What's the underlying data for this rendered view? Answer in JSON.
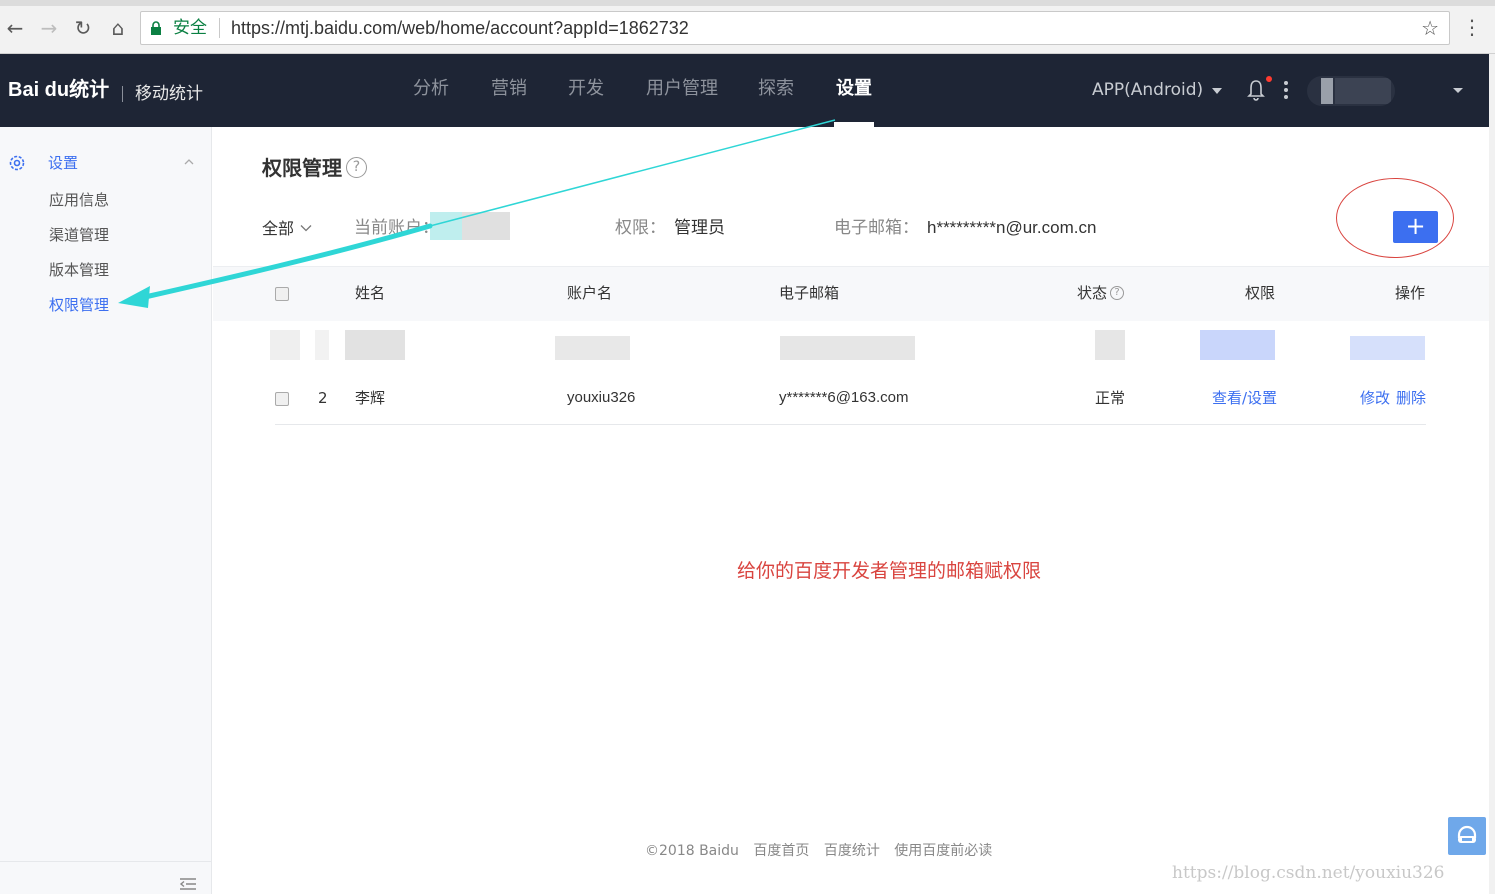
{
  "browser": {
    "secure_label": "安全",
    "url": "https://mtj.baidu.com/web/home/account?appId=1862732"
  },
  "header": {
    "logo": "Bai du统计",
    "product": "移动统计",
    "nav": [
      "分析",
      "营销",
      "开发",
      "用户管理",
      "探索",
      "设置"
    ],
    "active_nav": "设置",
    "app_select": "APP(Android)"
  },
  "sidebar": {
    "group": "设置",
    "items": [
      "应用信息",
      "渠道管理",
      "版本管理",
      "权限管理"
    ],
    "active_item": "权限管理"
  },
  "main": {
    "title": "权限管理",
    "help": "?",
    "filter": "全部",
    "current_account_label": "当前账户：",
    "permission_label": "权限：",
    "permission_value": "管理员",
    "email_label": "电子邮箱：",
    "email_value": "h*********n@ur.com.cn",
    "add_label": "+"
  },
  "table": {
    "columns": [
      "姓名",
      "账户名",
      "电子邮箱",
      "状态",
      "权限",
      "操作"
    ],
    "rows": [
      {
        "index": "2",
        "name": "李辉",
        "account": "youxiu326",
        "email": "y*******6@163.com",
        "status": "正常",
        "permission": "查看/设置",
        "edit": "修改",
        "delete": "删除"
      }
    ]
  },
  "annotation": "给你的百度开发者管理的邮箱赋权限",
  "footer": {
    "copyright": "©2018 Baidu",
    "links": [
      "百度首页",
      "百度统计",
      "使用百度前必读"
    ]
  },
  "watermark": "https://blog.csdn.net/youxiu326",
  "colors": {
    "accent": "#3c6ff0",
    "header_bg": "#1e2535",
    "annotation": "#d9443f",
    "arrow": "#2fd6d6"
  }
}
